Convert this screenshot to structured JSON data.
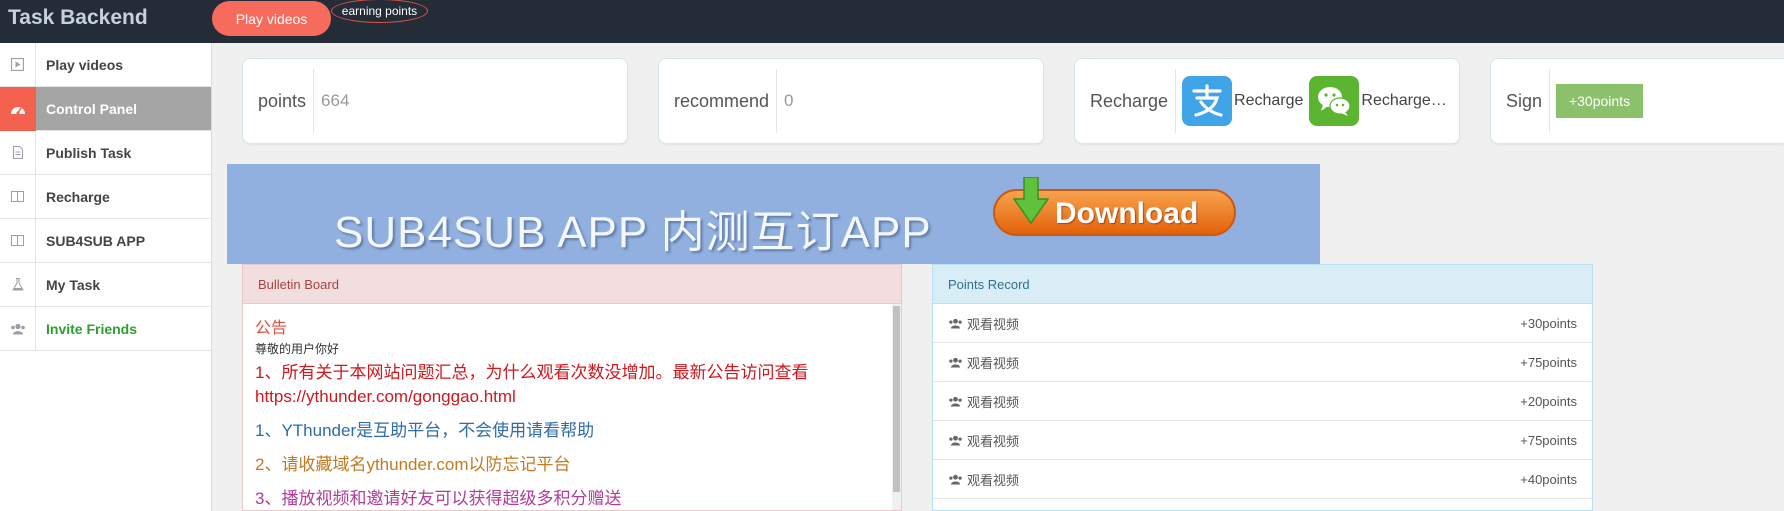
{
  "app": {
    "title": "Task Backend"
  },
  "header": {
    "play_label": "Play videos",
    "earn_label": "earning points"
  },
  "sidebar": {
    "items": [
      {
        "label": "Play videos",
        "icon": "play-icon"
      },
      {
        "label": "Control Panel",
        "icon": "dashboard-icon"
      },
      {
        "label": "Publish Task",
        "icon": "file-icon"
      },
      {
        "label": "Recharge",
        "icon": "columns-icon"
      },
      {
        "label": "SUB4SUB APP",
        "icon": "columns-icon"
      },
      {
        "label": "My Task",
        "icon": "flask-icon"
      },
      {
        "label": "Invite Friends",
        "icon": "users-icon"
      }
    ]
  },
  "cards": {
    "points": {
      "label": "points",
      "value": "664"
    },
    "recommend": {
      "label": "recommend",
      "value": "0"
    },
    "recharge": {
      "label": "Recharge",
      "alipay_label": "Recharge",
      "wechat_label": "Recharge…"
    },
    "sign": {
      "label": "Sign",
      "button": "+30points"
    }
  },
  "banner": {
    "text": "SUB4SUB APP 内测互订APP",
    "download_label": "Download"
  },
  "bulletin": {
    "title": "Bulletin Board",
    "heading": "公告",
    "greeting": "尊敬的用户你好",
    "lines": [
      "1、所有关于本网站问题汇总，为什么观看次数没增加。最新公告访问查看 https://ythunder.com/gonggao.html",
      "1、YThunder是互助平台，不会使用请看帮助",
      "2、请收藏域名ythunder.com以防忘记平台",
      "3、播放视频和邀请好友可以获得超级多积分赠送"
    ]
  },
  "points_record": {
    "title": "Points Record",
    "rows": [
      {
        "label": "观看视频",
        "points": "+30points"
      },
      {
        "label": "观看视频",
        "points": "+75points"
      },
      {
        "label": "观看视频",
        "points": "+20points"
      },
      {
        "label": "观看视频",
        "points": "+75points"
      },
      {
        "label": "观看视频",
        "points": "+40points"
      }
    ]
  },
  "colors": {
    "topbar": "#232c37",
    "accent": "#f76b5c",
    "sign_button": "#8cc06a",
    "alipay": "#3fa4e8",
    "wechat": "#5cb531",
    "invite_green": "#2aa12f"
  }
}
